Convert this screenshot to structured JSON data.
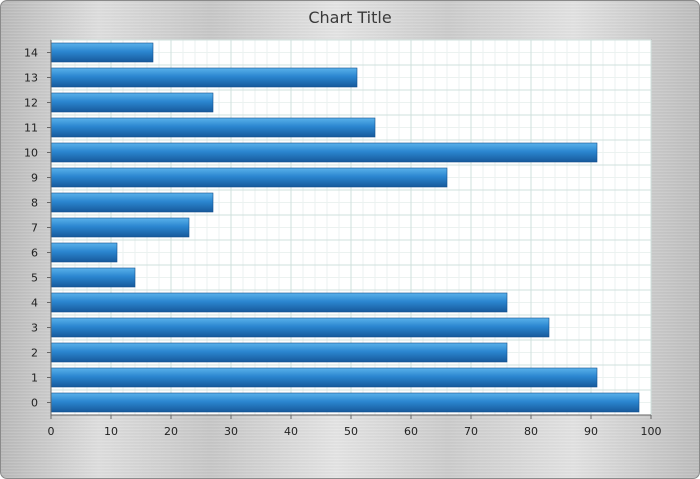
{
  "chart_data": {
    "type": "bar",
    "orientation": "horizontal",
    "title": "Chart Title",
    "xlabel": "",
    "ylabel": "",
    "categories": [
      "0",
      "1",
      "2",
      "3",
      "4",
      "5",
      "6",
      "7",
      "8",
      "9",
      "10",
      "11",
      "12",
      "13",
      "14"
    ],
    "values": [
      98,
      91,
      76,
      83,
      76,
      14,
      11,
      23,
      27,
      66,
      91,
      54,
      27,
      51,
      17
    ],
    "xlim": [
      0,
      100
    ],
    "x_ticks": [
      0,
      10,
      20,
      30,
      40,
      50,
      60,
      70,
      80,
      90,
      100
    ],
    "grid": true,
    "legend": "none",
    "colors": {
      "bar_top": "#5ab2ea",
      "bar_mid": "#2b86d0",
      "bar_bottom": "#175a9c",
      "bar_stroke": "#134f8c",
      "plot_background": "#ffffff",
      "grid_major": "#cfe0dc",
      "grid_minor": "#ebf2f0"
    }
  }
}
